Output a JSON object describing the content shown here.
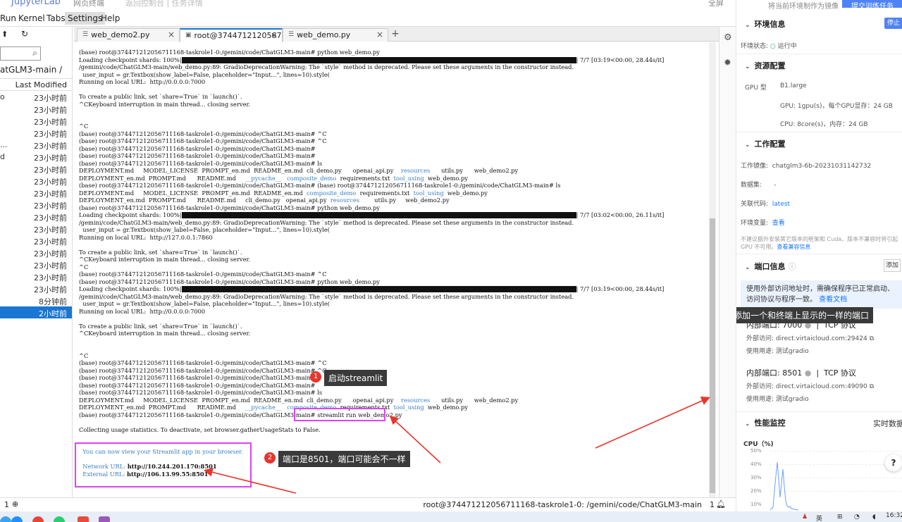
{
  "topbar": {
    "brand": "JupyterLab",
    "item2": "网页终端",
    "item3": "返回控制台 | 任务详情",
    "item4": "全屏"
  },
  "menu": [
    "Run",
    "Kernel",
    "Tabs",
    "Settings",
    "Help"
  ],
  "filebrowser": {
    "breadcrumb": "atGLM3-main /",
    "column_header": "Last Modified",
    "rows": [
      {
        "name": "o",
        "time": "23小时前"
      },
      {
        "name": "",
        "time": "23小时前"
      },
      {
        "name": "",
        "time": "23小时前"
      },
      {
        "name": "",
        "time": "23小时前"
      },
      {
        "name": "...",
        "time": "23小时前"
      },
      {
        "name": "d",
        "time": "23小时前"
      },
      {
        "name": "",
        "time": "23小时前"
      },
      {
        "name": "",
        "time": "23小时前"
      },
      {
        "name": "",
        "time": "23小时前"
      },
      {
        "name": "",
        "time": "23小时前"
      },
      {
        "name": "",
        "time": "23小时前"
      },
      {
        "name": "",
        "time": "23小时前"
      },
      {
        "name": "",
        "time": "23小时前"
      },
      {
        "name": "",
        "time": "23小时前"
      },
      {
        "name": "",
        "time": "23小时前"
      },
      {
        "name": "",
        "time": "23小时前"
      },
      {
        "name": "",
        "time": "23小时前"
      },
      {
        "name": "",
        "time": "8分钟前"
      },
      {
        "name": "",
        "time": "2小时前",
        "selected": true
      }
    ]
  },
  "tabs": [
    {
      "label": "web_demo2.py",
      "icon": "file-icon",
      "active": false
    },
    {
      "label": "root@374471212056711\u0000",
      "icon": "terminal-icon",
      "active": true
    },
    {
      "label": "web_demo.py",
      "icon": "file-icon",
      "active": false
    }
  ],
  "terminal": {
    "lines": [
      {
        "t": "(base) root@374471212056711168-taskrole1-0:/gemini/code/ChatGLM3-main# python web_demo.py"
      },
      {
        "t": "Loading checkpoint shards: 100%|",
        "bar": true,
        "after": "| 7/7 [03:19<00:00, 28.44s/it]"
      },
      {
        "t": "/gemini/code/ChatGLM3-main/web_demo.py:89: GradioDeprecationWarning: The `style` method is deprecated. Please set these arguments in the constructor instead."
      },
      {
        "t": "  user_input = gr.Textbox(show_label=False, placeholder=\"Input...\", lines=10).style("
      },
      {
        "t": "Running on local URL:  http://0.0.0.0:7000"
      },
      {
        "t": ""
      },
      {
        "t": "To create a public link, set `share=True` in `launch()`."
      },
      {
        "t": "^CKeyboard interruption in main thread... closing server."
      },
      {
        "t": ""
      },
      {
        "t": ""
      },
      {
        "t": "^C"
      },
      {
        "t": "(base) root@374471212056711168-taskrole1-0:/gemini/code/ChatGLM3-main# ^C"
      },
      {
        "t": "(base) root@374471212056711168-taskrole1-0:/gemini/code/ChatGLM3-main# ^C"
      },
      {
        "t": "(base) root@374471212056711168-taskrole1-0:/gemini/code/ChatGLM3-main#"
      },
      {
        "t": "(base) root@374471212056711168-taskrole1-0:/gemini/code/ChatGLM3-main#"
      },
      {
        "t": "(base) root@374471212056711168-taskrole1-0:/gemini/code/ChatGLM3-main# ls"
      },
      {
        "t": "DEPLOYMENT.md     MODEL_LICENSE  PROMPT_en.md  README_en.md  cli_demo.py      openai_api.py    ",
        "c": "resources",
        "after": "      utils.py      web_demo2.py"
      },
      {
        "t": "DEPLOYMENT_en.md  PROMPT.md      README.md     ",
        "c": "__pycache__   composite_demo",
        "after": "  requirements.txt  ",
        "c2": "tool_using",
        "after2": "  web_demo.py"
      },
      {
        "t": "(base) root@374471212056711168-taskrole1-0:/gemini/code/ChatGLM3-main# (base) root@374471212056711168-taskrole1-0:/gemini/code/ChatGLM3-main# ls"
      },
      {
        "t": "DEPLOYMENT.md     MODEL_LICENSE  PROMPT_en.md  README_en.md  ",
        "c": "composite_demo",
        "after": "  requirements.txt  ",
        "c2": "tool_using",
        "after2": "  web_demo.py"
      },
      {
        "t": "DEPLOYMENT_en.md  PROMPT.md      README.md     cli_demo.py   openai_api.py  ",
        "c": "resources",
        "after": "        utils.py     web_demo2.py"
      },
      {
        "t": "(base) root@374471212056711168-taskrole1-0:/gemini/code/ChatGLM3-main# python web_demo.py"
      },
      {
        "t": "Loading checkpoint shards: 100%|",
        "bar": true,
        "after": "| 7/7 [03:02<00:00, 26.11s/it]"
      },
      {
        "t": "/gemini/code/ChatGLM3-main/web_demo.py:89: GradioDeprecationWarning: The `style` method is deprecated. Please set these arguments in the constructor instead."
      },
      {
        "t": "  user_input = gr.Textbox(show_label=False, placeholder=\"Input...\", lines=10).style("
      },
      {
        "t": "Running on local URL:  http://127.0.0.1:7860"
      },
      {
        "t": ""
      },
      {
        "t": "To create a public link, set `share=True` in `launch()`."
      },
      {
        "t": "^CKeyboard interruption in main thread... closing server."
      },
      {
        "t": "^C"
      },
      {
        "t": "(base) root@374471212056711168-taskrole1-0:/gemini/code/ChatGLM3-main# ^C"
      },
      {
        "t": "(base) root@374471212056711168-taskrole1-0:/gemini/code/ChatGLM3-main# python web_demo.py"
      },
      {
        "t": "Loading checkpoint shards: 100%|",
        "bar": true,
        "after": "| 7/7 [03:19<00:00, 28.44s/it]"
      },
      {
        "t": "/gemini/code/ChatGLM3-main/web_demo.py:89: GradioDeprecationWarning: The `style` method is deprecated. Please set these arguments in the constructor instead."
      },
      {
        "t": "  user_input = gr.Textbox(show_label=False, placeholder=\"Input...\", lines=10).style("
      },
      {
        "t": "Running on local URL:  http://0.0.0.0:7000"
      },
      {
        "t": ""
      },
      {
        "t": "To create a public link, set `share=True` in `launch()`."
      },
      {
        "t": "^CKeyboard interruption in main thread... closing server."
      },
      {
        "t": ""
      },
      {
        "t": ""
      },
      {
        "t": "^C"
      },
      {
        "t": "(base) root@374471212056711168-taskrole1-0:/gemini/code/ChatGLM3-main# ^C"
      },
      {
        "t": "(base) root@374471212056711168-taskrole1-0:/gemini/code/ChatGLM3-main# ^C"
      },
      {
        "t": "(base) root@374471212056711168-taskrole1-0:/gemini/code/ChatGLM3-main#"
      },
      {
        "t": "(base) root@374471212056711168-taskrole1-0:/gemini/code/ChatGLM3-main#"
      },
      {
        "t": "(base) root@374471212056711168-taskrole1-0:/gemini/code/ChatGLM3-main# ls"
      },
      {
        "t": "DEPLOYMENT.md     MODEL_LICENSE  PROMPT_en.md  README_en.md  cli_demo.py      openai_api.py    ",
        "c": "resources",
        "after": "      utils.py      web_demo2.py"
      },
      {
        "t": "DEPLOYMENT_en.md  PROMPT.md      README.md     ",
        "c": "__pycache__   composite_demo",
        "after": "  requirements.txt  ",
        "c2": "tool_using",
        "after2": "  web_demo.py"
      },
      {
        "t": "(base) root@374471212056711168-taskrole1-0:/gemini/code/ChatGLM3-main# streamlit run web_demo2.py"
      },
      {
        "t": ""
      },
      {
        "t": "Collecting usage statistics. To deactivate, set browser.gatherUsageStats to False."
      },
      {
        "t": ""
      },
      {
        "t": ""
      },
      {
        "t": "  You can now view your Streamlit app in your browser.",
        "cls": "cyan"
      },
      {
        "t": ""
      },
      {
        "t": "  Network URL: ",
        "cls": "cyan",
        "after": "http://10.244.201.170:8501",
        "afterBold": true
      },
      {
        "t": "  External URL: ",
        "cls": "cyan",
        "after": "http://106.13.99.55:8501",
        "afterBold": true
      }
    ]
  },
  "annotations": {
    "a1": {
      "num": "1",
      "text": "启动streamlit"
    },
    "a2": {
      "num": "2",
      "text": "端口是8501，端口可能会不一样"
    },
    "a3": {
      "num": "3",
      "text": "添加一个和终端上显示的一样的端口"
    }
  },
  "statusbar": {
    "left_num": "1",
    "path": "root@374471212056711168-taskrole1-0: /gemini/code/ChatGLM3-main",
    "right_num": "1"
  },
  "panel": {
    "top_btn1": "将当前环境制作为镜像",
    "top_btn2": "提交训练任务",
    "env": {
      "title": "环境信息",
      "stop": "停止",
      "status_label": "环境状态:",
      "status_value": "运行中"
    },
    "res": {
      "title": "资源配置",
      "gpu_label": "GPU 型",
      "gpu_model": "B1.large",
      "gpu_line": "GPU:   1gpu(s)，每个GPU显存：24 GB",
      "cpu_line": "CPU:   8core(s)，内存：24 GB"
    },
    "work": {
      "title": "工作配置",
      "image_label": "工作镜像:",
      "image_value": "chatglm3-6b-20231031142732",
      "dataset_label": "数据集:",
      "dataset_value": "-",
      "code_label": "关联代码:",
      "code_value": "latest",
      "envvar_label": "环境变量:",
      "envvar_value": "查看",
      "warn1": "不建议额外安装其它版本的框架和 Cuda，版本不兼容时将引起",
      "warn2": "GPU 不可用。",
      "warn_link": "查看兼容信息"
    },
    "ports": {
      "title": "端口信息",
      "add": "添加",
      "notice": "使用外部访问地址时，需确保程序已正常启动、访问协议与程序一致。",
      "notice_link": "查看文档",
      "items": [
        {
          "internal_label": "内部端口:",
          "internal": "7000",
          "proto": "TCP 协议",
          "ext_label": "外部访问:",
          "external": "direct.virtaicloud.com:29424",
          "use_label": "使用用途:",
          "use": "测试gradio"
        },
        {
          "internal_label": "内部端口:",
          "internal": "8501",
          "proto": "TCP 协议",
          "ext_label": "外部访问:",
          "external": "direct.virtaicloud.com:49090",
          "use_label": "使用用途:",
          "use": "测试gradio"
        }
      ]
    },
    "perf": {
      "title": "性能监控",
      "realtime": "实时数据",
      "cpu_label": "CPU（%)",
      "yticks": [
        "50%",
        "40%",
        "30%",
        "20%",
        "10%"
      ]
    }
  },
  "taskbar": {
    "lang": "英",
    "time": "16:32"
  },
  "colors": {
    "accent": "#1976d2",
    "annotation_pink": "#d946ef",
    "annotation_red": "#e8352d",
    "panel_blue": "#4e83f5",
    "link": "#1677ff"
  }
}
